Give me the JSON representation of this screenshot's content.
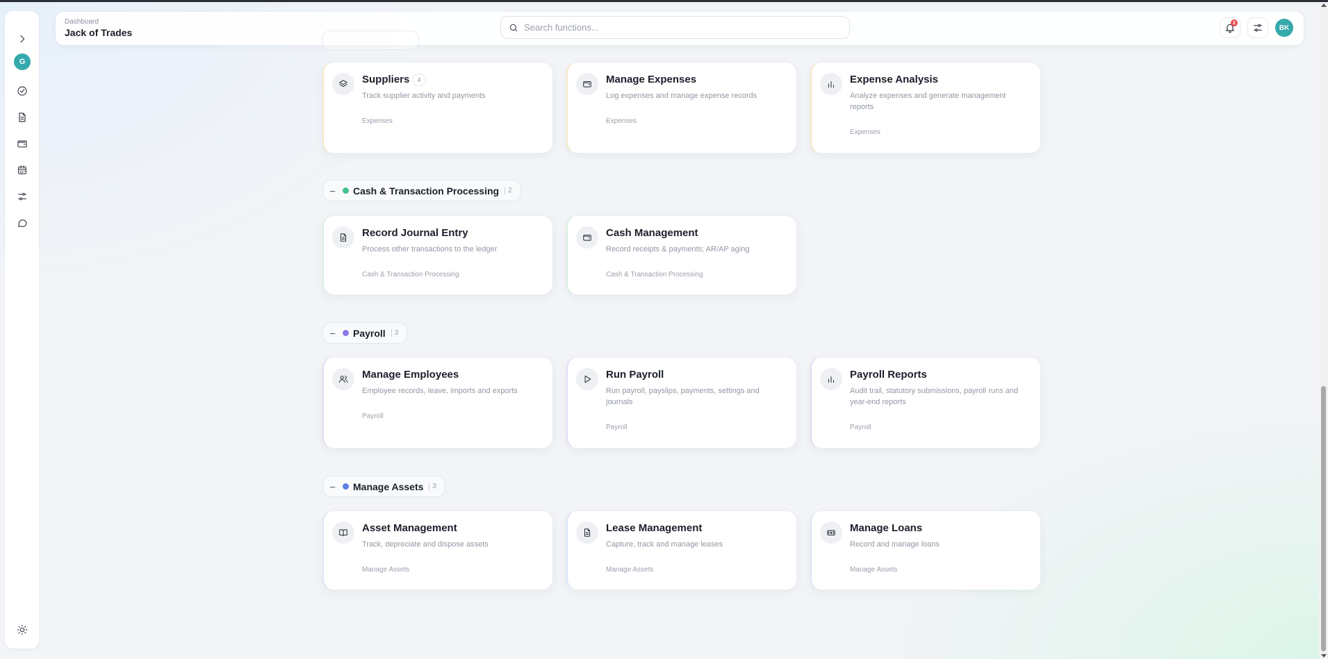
{
  "header": {
    "breadcrumb": "Dashboard",
    "title": "Jack of Trades",
    "search_placeholder": "Search functions...",
    "notification_count": "2",
    "user_initials": "BK"
  },
  "sidebar": {
    "avatar_initial": "G",
    "items": [
      {
        "icon": "chevron-right-icon"
      },
      {
        "icon": "check-circle-icon"
      },
      {
        "icon": "document-icon"
      },
      {
        "icon": "wallet-icon"
      },
      {
        "icon": "calendar-icon"
      },
      {
        "icon": "sliders-icon"
      },
      {
        "icon": "chat-icon"
      },
      {
        "icon": "sun-icon"
      }
    ]
  },
  "sections": {
    "expenses": {
      "cards": [
        {
          "title": "Suppliers",
          "count": "4",
          "description": "Track supplier activity and payments",
          "category": "Expenses",
          "icon": "layers-icon"
        },
        {
          "title": "Manage Expenses",
          "description": "Log expenses and manage expense records",
          "category": "Expenses",
          "icon": "wallet-icon"
        },
        {
          "title": "Expense Analysis",
          "description": "Analyze expenses and generate management reports",
          "category": "Expenses",
          "icon": "bar-chart-icon"
        }
      ]
    },
    "cash": {
      "name": "Cash & Transaction Processing",
      "count": "2",
      "dot_color": "#3fbf8a",
      "cards": [
        {
          "title": "Record Journal Entry",
          "description": "Process other transactions to the ledger",
          "category": "Cash & Transaction Processing",
          "icon": "document-icon"
        },
        {
          "title": "Cash Management",
          "description": "Record receipts & payments; AR/AP aging",
          "category": "Cash & Transaction Processing",
          "icon": "wallet-icon"
        }
      ]
    },
    "payroll": {
      "name": "Payroll",
      "count": "3",
      "dot_color": "#8b78e6",
      "cards": [
        {
          "title": "Manage Employees",
          "description": "Employee records, leave, imports and exports",
          "category": "Payroll",
          "icon": "users-icon"
        },
        {
          "title": "Run Payroll",
          "description": "Run payroll, payslips, payments, settings and journals",
          "category": "Payroll",
          "icon": "play-icon"
        },
        {
          "title": "Payroll Reports",
          "description": "Audit trail, statutory submissions, payroll runs and year-end reports",
          "category": "Payroll",
          "icon": "bar-chart-icon"
        }
      ]
    },
    "assets": {
      "name": "Manage Assets",
      "count": "3",
      "dot_color": "#5b7fe0",
      "cards": [
        {
          "title": "Asset Management",
          "description": "Track, depreciate and dispose assets",
          "category": "Manage Assets",
          "icon": "book-icon"
        },
        {
          "title": "Lease Management",
          "description": "Capture, track and manage leases",
          "category": "Manage Assets",
          "icon": "document-icon"
        },
        {
          "title": "Manage Loans",
          "description": "Record and manage loans",
          "category": "Manage Assets",
          "icon": "cash-icon"
        }
      ]
    }
  }
}
